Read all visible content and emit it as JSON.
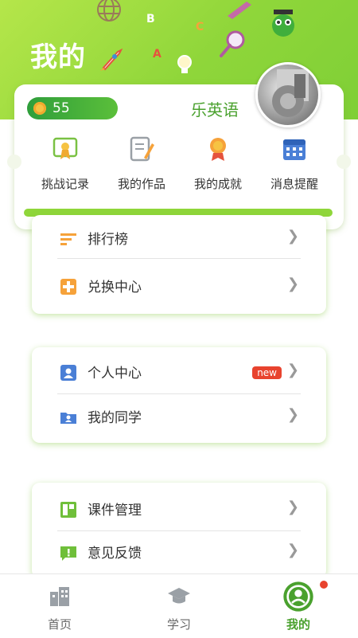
{
  "header": {
    "title": "我的"
  },
  "profile": {
    "coins": "55",
    "username": "乐英语"
  },
  "shortcuts": [
    {
      "label": "挑战记录",
      "icon": "certificate-icon"
    },
    {
      "label": "我的作品",
      "icon": "notebook-pen-icon"
    },
    {
      "label": "我的成就",
      "icon": "medal-icon"
    },
    {
      "label": "消息提醒",
      "icon": "calendar-icon"
    }
  ],
  "menu": {
    "group1": [
      {
        "label": "排行榜",
        "icon": "ranking-icon"
      },
      {
        "label": "兑换中心",
        "icon": "exchange-icon"
      }
    ],
    "group2": [
      {
        "label": "个人中心",
        "icon": "person-card-icon",
        "badge": "new"
      },
      {
        "label": "我的同学",
        "icon": "classmates-folder-icon"
      }
    ],
    "group3": [
      {
        "label": "课件管理",
        "icon": "courseware-icon"
      },
      {
        "label": "意见反馈",
        "icon": "feedback-icon"
      }
    ]
  },
  "tabbar": [
    {
      "label": "首页",
      "icon": "buildings-icon"
    },
    {
      "label": "学习",
      "icon": "graduation-cap-icon"
    },
    {
      "label": "我的",
      "icon": "profile-circle-icon",
      "active": true
    }
  ],
  "colors": {
    "accent": "#8fd63a",
    "active_tab": "#4aa12e",
    "badge": "#e8432e"
  }
}
